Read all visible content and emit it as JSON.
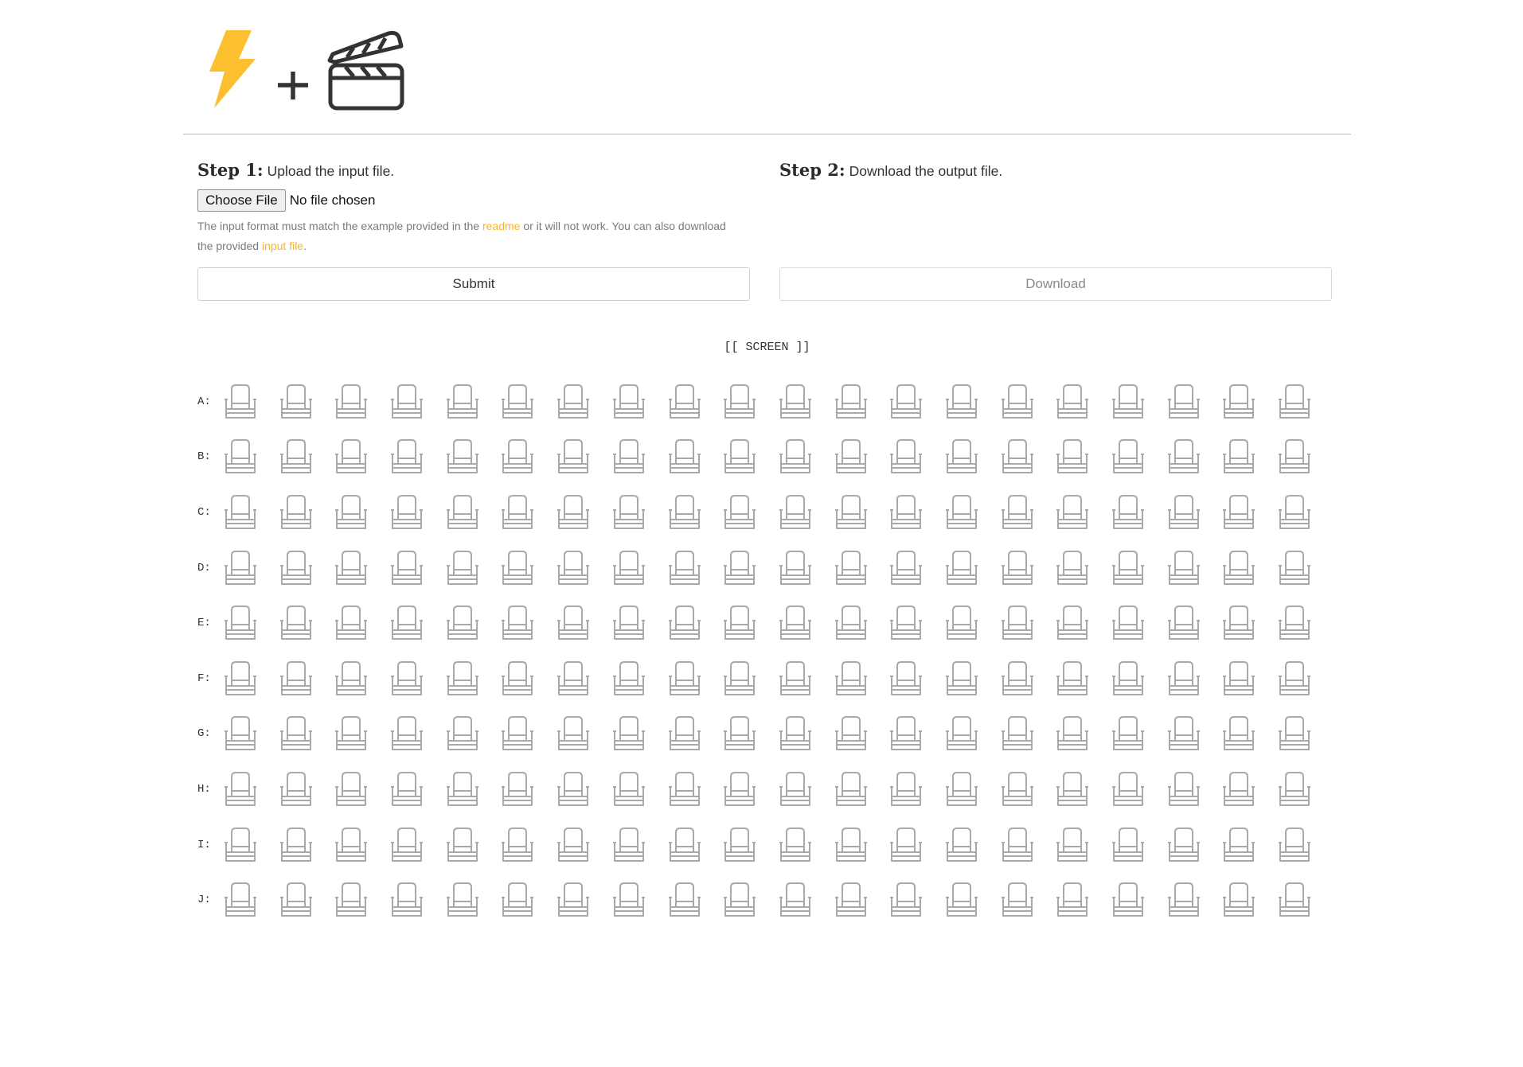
{
  "header": {
    "logo_icons": [
      "lightning-bolt-icon",
      "plus-icon",
      "clapperboard-icon"
    ],
    "bolt_color": "#fbbf2f"
  },
  "step1": {
    "label": "Step 1:",
    "description": "Upload the input file.",
    "file_button_label": "Choose File",
    "file_status": "No file chosen",
    "help_text_1": "The input format must match the example provided in the ",
    "help_link_readme": "readme",
    "help_text_2": " or it will not work. You can also download the provided ",
    "help_link_input": "input file",
    "help_text_3": ".",
    "submit_label": "Submit"
  },
  "step2": {
    "label": "Step 2:",
    "description": "Download the output file.",
    "download_label": "Download"
  },
  "seat_map": {
    "screen_label": "[[ SCREEN ]]",
    "rows": [
      "A:",
      "B:",
      "C:",
      "D:",
      "E:",
      "F:",
      "G:",
      "H:",
      "I:",
      "J:"
    ],
    "seats_per_row": 20,
    "seat_icon": "seat-icon",
    "seat_color": "#a9a9a9"
  },
  "colors": {
    "link": "#f4b52b",
    "text": "#333333",
    "muted_text": "#7a7a7a"
  }
}
